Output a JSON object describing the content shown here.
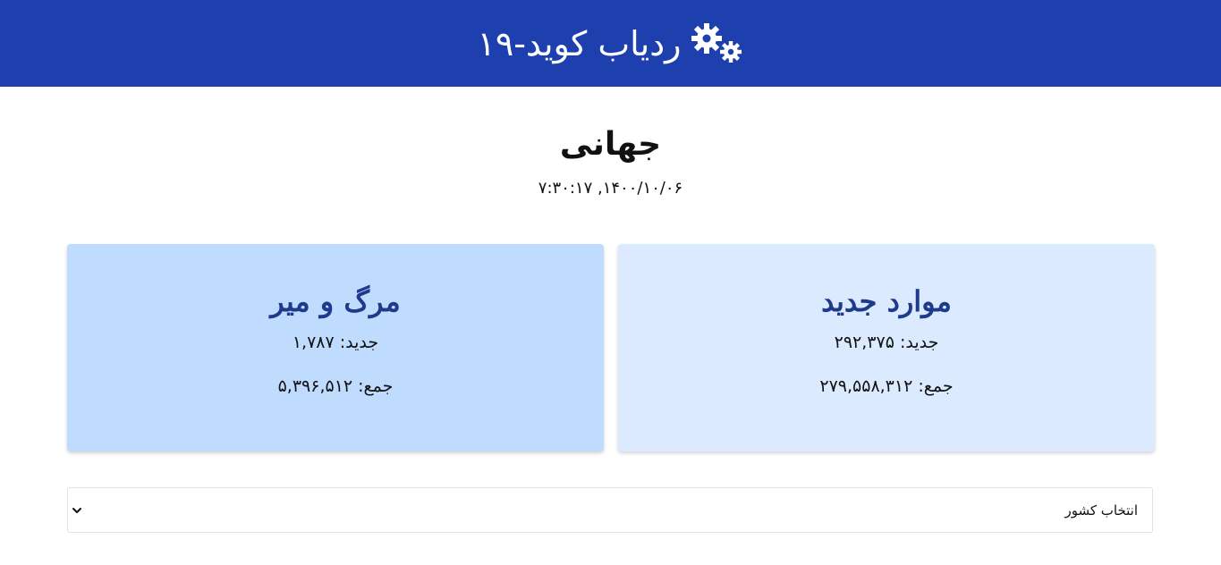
{
  "header": {
    "title": "ردیاب کوید-۱۹",
    "icon": "gears-icon",
    "background": "#1e40af"
  },
  "region": {
    "title": "جهانی",
    "date": "۱۴۰۰/۱۰/۰۶, ۷:۳۰:۱۷"
  },
  "cards": {
    "cases": {
      "title": "موارد جدید",
      "new_line": "جدید: ۲۹۲,۳۷۵",
      "total_line": "جمع: ۲۷۹,۵۵۸,۳۱۲",
      "background": "#dbeafe"
    },
    "deaths": {
      "title": "مرگ و میر",
      "new_line": "جدید: ۱,۷۸۷",
      "total_line": "جمع: ۵,۳۹۶,۵۱۲",
      "background": "#bfdbfe"
    }
  },
  "country_select": {
    "selected": "انتخاب کشور"
  },
  "colors": {
    "accent": "#1e40af",
    "card_title": "#1e3a8a"
  }
}
